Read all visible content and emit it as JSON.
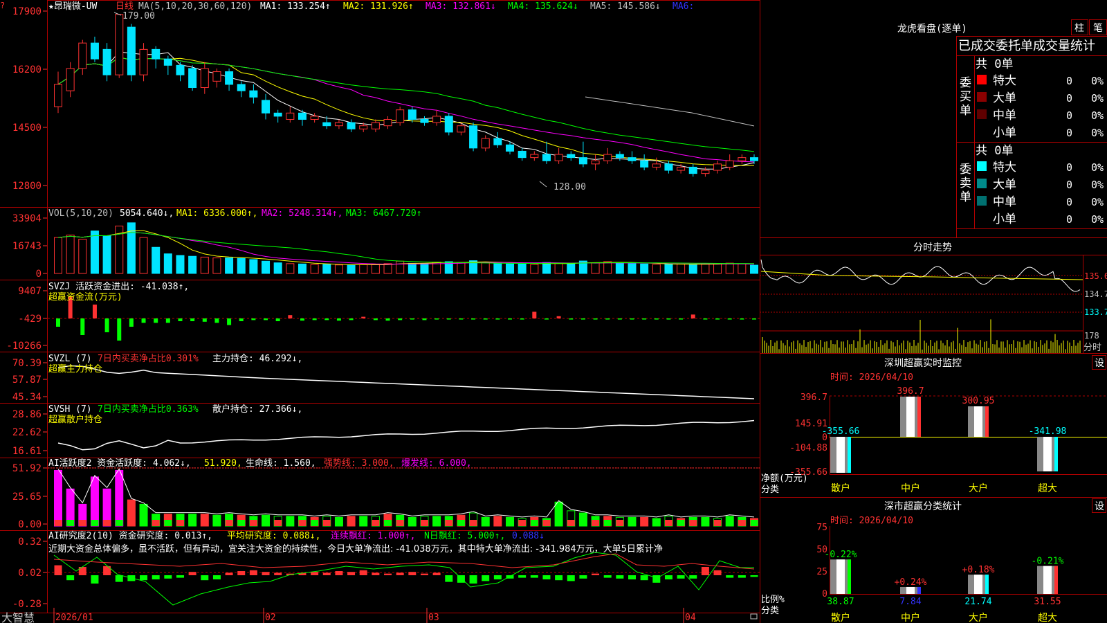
{
  "colors": {
    "up": "#ff3232",
    "down": "#00e4ff",
    "ma1": "#ffffff",
    "ma2": "#ffff00",
    "ma3": "#ff00ff",
    "ma4": "#00ff00",
    "ma5": "#c0c0c0",
    "grid": "#b00000",
    "axis": "#ff3232",
    "green": "#00ff00",
    "yellow": "#ffff00",
    "magenta": "#ff00ff",
    "cyan": "#00ffff",
    "white": "#ffffff",
    "blue": "#3333ff"
  },
  "app": {
    "logo": "大智慧",
    "stock": "★昂瑞微-UW",
    "period": "日线",
    "corner": "?"
  },
  "price_panel": {
    "ma_title": "MA(5,10,20,30,60,120)",
    "ma1": "MA1: 133.254↑",
    "ma2": "MA2: 131.926↑",
    "ma3": "MA3: 132.861↓",
    "ma4": "MA4: 135.624↓",
    "ma5": "MA5: 145.586↓",
    "ma6": "MA6:",
    "high_label": "179.00",
    "low_label": "128.00",
    "yticks": [
      "17900",
      "16200",
      "14500",
      "12800"
    ],
    "ylim": [
      120,
      182
    ]
  },
  "vol_panel": {
    "title": "VOL(5,10,20)",
    "value": "5054.640↓,",
    "ma1": "MA1: 6336.000↑,",
    "ma2": "MA2: 5248.314↑,",
    "ma3": "MA3: 6467.720↑",
    "yticks": [
      "33904",
      "16743",
      "0"
    ]
  },
  "svzj_panel": {
    "title": "SVZJ  活跃资金进出: -41.038↑,",
    "subtitle": "超赢资金流(万元)",
    "yticks": [
      "9407",
      "-429",
      "-10266"
    ]
  },
  "svzl_panel": {
    "title": "SVZL (7)",
    "pct": "7日内买卖净占比0.301%",
    "hold": "主力持仓: 46.292↓,",
    "subtitle": "超赢主力持仓",
    "yticks": [
      "70.39",
      "57.87",
      "45.34"
    ]
  },
  "svsh_panel": {
    "title": "SVSH (7)",
    "pct": "7日内买卖净占比0.363%",
    "hold": "散户持仓: 27.366↓,",
    "subtitle": "超赢散户持仓",
    "yticks": [
      "28.86",
      "22.62",
      "16.61"
    ]
  },
  "ai1_panel": {
    "title": "AI活跃度2 资金活跃度: 4.062↓,",
    "v2": "51.920,",
    "v3": "生命线: 1.560,",
    "v4": "强势线: 3.000,",
    "v5": "爆发线: 6.000,",
    "yticks": [
      "51.92",
      "25.65",
      "0.00"
    ]
  },
  "ai2_panel": {
    "title": "AI研究度2(10) 资金研究度: 0.013↑,",
    "v2": "平均研究度: 0.088↓,",
    "v3": "连续飘红: 1.000↑,",
    "v4": "N日飘红: 5.000↑,",
    "v5": "0.088↓",
    "note": "近期大资金总体偏多，虽不活跃，但有异动，宜关注大资金的持续性，今日大单净流出: -41.038万元，其中特大单净流出: -341.984万元，大单5日累计净",
    "yticks": [
      "0.32",
      "0.02",
      "-0.28"
    ]
  },
  "xaxis": {
    "labels": [
      "2026/01",
      "02",
      "03",
      "04"
    ]
  },
  "longhu": {
    "title": "龙虎看盘(逐单)",
    "btn1": "柱",
    "btn2": "笔",
    "header": "已成交委托单成交量统计",
    "buy": {
      "side": "委买单",
      "total": "共 0单",
      "rows": [
        {
          "name": "特大",
          "v": "0",
          "p": "0%"
        },
        {
          "name": "大单",
          "v": "0",
          "p": "0%"
        },
        {
          "name": "中单",
          "v": "0",
          "p": "0%"
        },
        {
          "name": "小单",
          "v": "0",
          "p": "0%"
        }
      ]
    },
    "sell": {
      "side": "委卖单",
      "total": "共 0单",
      "rows": [
        {
          "name": "特大",
          "v": "0",
          "p": "0%"
        },
        {
          "name": "大单",
          "v": "0",
          "p": "0%"
        },
        {
          "name": "中单",
          "v": "0",
          "p": "0%"
        },
        {
          "name": "小单",
          "v": "0",
          "p": "0%"
        }
      ]
    }
  },
  "intraday": {
    "title": "分时走势",
    "yticks": [
      "135.6",
      "134.7",
      "133.7"
    ],
    "vtick": "178",
    "vlabel": "分时"
  },
  "monitor": {
    "title": "深圳超赢实时监控",
    "btn": "设",
    "date": "时间: 2026/04/10",
    "yticks": [
      "396.7",
      "145.91",
      "0",
      "-104.88",
      "-355.66"
    ],
    "ylabel1": "净额(万元)",
    "ylabel2": "分类",
    "bars": [
      {
        "cat": "散户",
        "value": -355.66,
        "label": "-355.66"
      },
      {
        "cat": "中户",
        "value": 396.7,
        "label": "396.7"
      },
      {
        "cat": "大户",
        "value": 300.95,
        "label": "300.95"
      },
      {
        "cat": "超大",
        "value": -341.98,
        "label": "-341.98"
      }
    ]
  },
  "classify": {
    "title": "深市超赢分类统计",
    "btn": "设",
    "date": "时间: 2026/04/10",
    "yticks": [
      "75",
      "50",
      "25",
      "0"
    ],
    "ylabel1": "比例%",
    "ylabel2": "分类",
    "bars": [
      {
        "cat": "散户",
        "value": 38.87,
        "label": "38.87",
        "chg": "-0.22%"
      },
      {
        "cat": "中户",
        "value": 7.84,
        "label": "7.84",
        "chg": "+0.24%"
      },
      {
        "cat": "大户",
        "value": 21.74,
        "label": "21.74",
        "chg": "+0.18%"
      },
      {
        "cat": "超大",
        "value": 31.55,
        "label": "31.55",
        "chg": "-0.21%"
      }
    ]
  },
  "chart_data": {
    "type": "candlestick",
    "candles": [
      [
        150,
        157,
        148,
        161
      ],
      [
        155,
        162,
        153,
        164
      ],
      [
        162,
        170,
        160,
        171
      ],
      [
        170,
        165,
        164,
        172
      ],
      [
        168,
        160,
        158,
        170
      ],
      [
        160,
        179,
        159,
        179
      ],
      [
        175,
        160,
        158,
        176
      ],
      [
        160,
        168,
        158,
        170
      ],
      [
        168,
        165,
        162,
        169
      ],
      [
        165,
        163,
        160,
        166
      ],
      [
        163,
        160,
        158,
        164
      ],
      [
        162,
        156,
        155,
        163
      ],
      [
        156,
        162,
        154,
        164
      ],
      [
        158,
        161,
        156,
        162
      ],
      [
        161,
        157,
        155,
        162
      ],
      [
        157,
        155,
        153,
        158
      ],
      [
        155,
        153,
        151,
        157
      ],
      [
        152,
        148,
        146,
        154
      ],
      [
        148,
        147,
        145,
        149
      ],
      [
        146,
        148,
        145,
        150
      ],
      [
        148,
        146,
        144,
        149
      ],
      [
        146,
        147,
        145,
        148
      ],
      [
        145,
        144,
        143,
        147
      ],
      [
        144,
        145,
        143,
        146
      ],
      [
        145,
        143,
        142,
        146
      ],
      [
        143,
        144,
        142,
        145
      ],
      [
        143,
        145,
        142,
        146
      ],
      [
        144,
        146,
        143,
        147
      ],
      [
        145,
        149,
        144,
        150
      ],
      [
        149,
        146,
        145,
        150
      ],
      [
        146,
        145,
        144,
        147
      ],
      [
        145,
        147,
        144,
        149
      ],
      [
        147,
        142,
        141,
        148
      ],
      [
        142,
        144,
        141,
        145
      ],
      [
        144,
        137,
        136,
        145
      ],
      [
        137,
        140,
        136,
        141
      ],
      [
        140,
        138,
        137,
        142
      ],
      [
        138,
        136,
        135,
        139
      ],
      [
        136,
        134,
        133,
        137
      ],
      [
        134,
        135,
        133,
        136
      ],
      [
        135,
        133,
        132,
        139
      ],
      [
        133,
        135,
        132,
        137
      ],
      [
        135,
        134,
        133,
        136
      ],
      [
        134,
        132,
        131,
        139
      ],
      [
        132,
        133,
        130,
        135
      ],
      [
        133,
        135,
        132,
        137
      ],
      [
        135,
        134,
        133,
        136
      ],
      [
        134,
        133,
        132,
        136
      ],
      [
        133,
        131,
        130,
        135
      ],
      [
        131,
        132,
        130,
        134
      ],
      [
        132,
        130,
        129,
        133
      ],
      [
        130,
        131,
        129,
        132
      ],
      [
        131,
        129,
        128,
        132
      ],
      [
        129,
        130,
        128,
        131
      ],
      [
        130,
        132,
        129,
        133
      ],
      [
        131,
        133,
        130,
        135
      ],
      [
        133,
        134,
        132,
        135
      ],
      [
        134,
        133,
        132,
        135
      ]
    ],
    "volume": [
      22000,
      23500,
      21000,
      26000,
      23000,
      29000,
      31000,
      22000,
      16000,
      12000,
      11000,
      10500,
      10000,
      9500,
      9500,
      9200,
      8500,
      7500,
      6500,
      6000,
      5800,
      5500,
      5600,
      5200,
      5000,
      5400,
      5600,
      6000,
      7500,
      6200,
      6000,
      7000,
      7200,
      6800,
      7800,
      6500,
      6200,
      5900,
      5800,
      5600,
      6700,
      6200,
      6100,
      7600,
      6500,
      7200,
      6400,
      6000,
      5800,
      5600,
      5500,
      5700,
      5400,
      5800,
      6100,
      6300,
      5900,
      5054
    ]
  }
}
